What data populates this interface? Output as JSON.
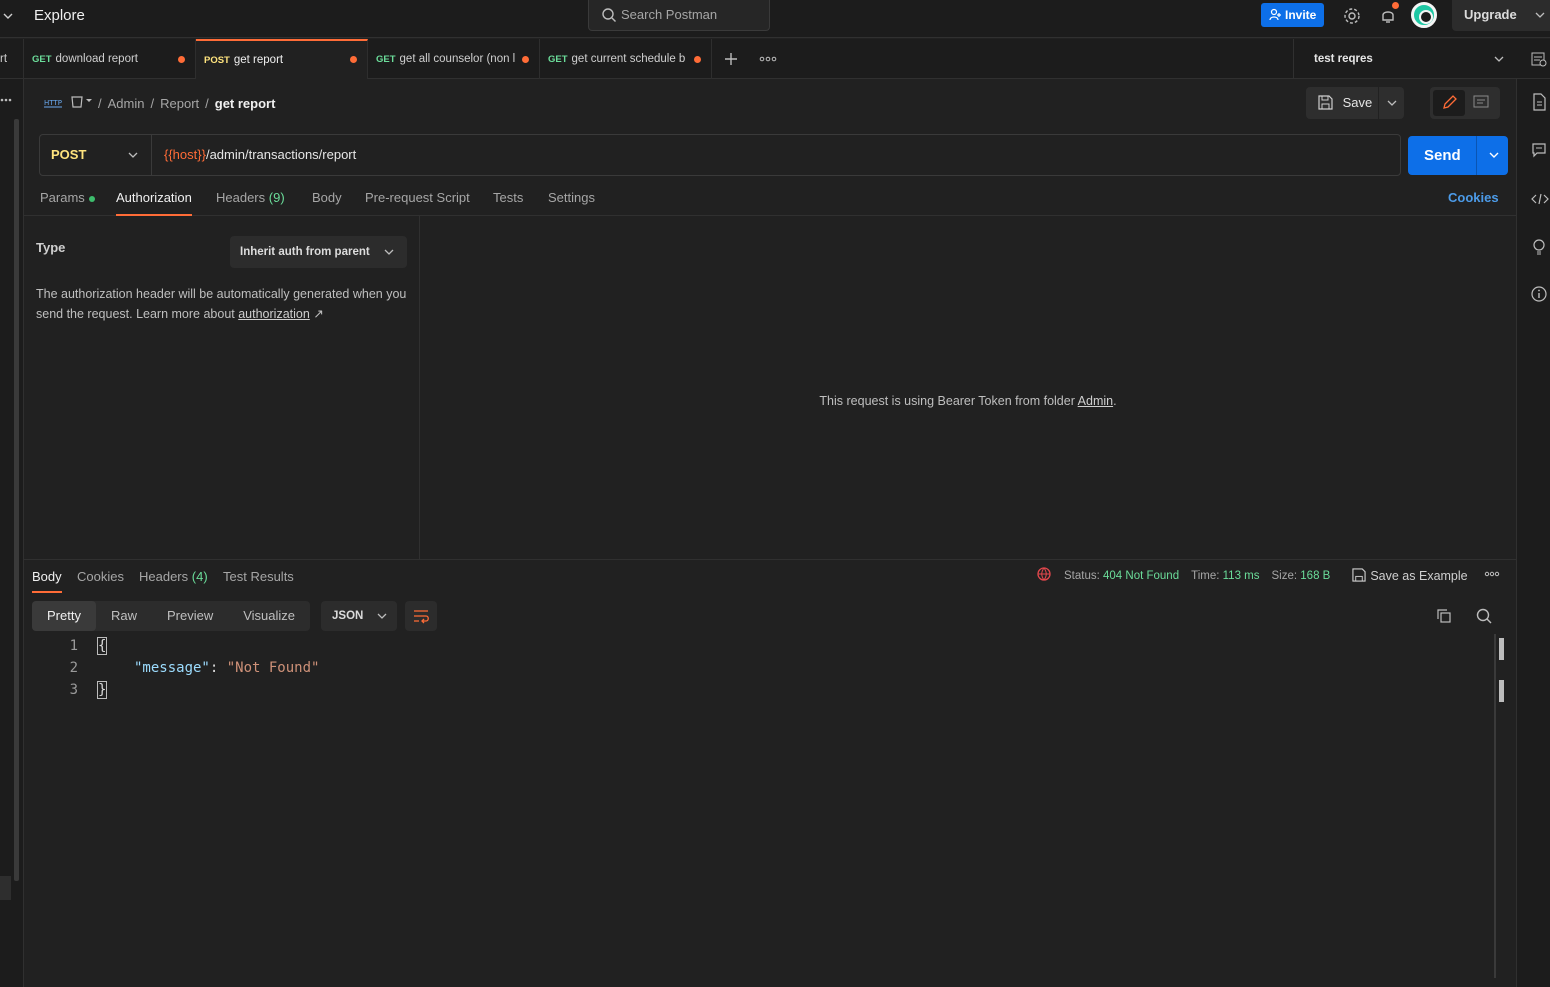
{
  "topbar": {
    "title": "Explore",
    "search_placeholder": "Search Postman",
    "invite_label": "Invite",
    "upgrade_label": "Upgrade"
  },
  "tabs": [
    {
      "prefix": "rt"
    },
    {
      "method": "GET",
      "label": "download report",
      "unsaved": true
    },
    {
      "method": "POST",
      "label": "get report",
      "unsaved": true,
      "active": true
    },
    {
      "method": "GET",
      "label": "get all counselor (non l",
      "unsaved": true
    },
    {
      "method": "GET",
      "label": "get current schedule b",
      "unsaved": true
    }
  ],
  "environment": {
    "name": "test reqres"
  },
  "breadcrumb": {
    "items": [
      "Admin",
      "Report"
    ],
    "current": "get report"
  },
  "save_label": "Save",
  "request": {
    "method": "POST",
    "url_var": "{{host}}",
    "url_path": "/admin/transactions/report",
    "send_label": "Send"
  },
  "request_tabs": {
    "params": "Params",
    "authorization": "Authorization",
    "headers": "Headers",
    "headers_count": "(9)",
    "body": "Body",
    "prerequest": "Pre-request Script",
    "tests": "Tests",
    "settings": "Settings",
    "cookies": "Cookies"
  },
  "auth": {
    "type_label": "Type",
    "type_value": "Inherit auth from parent",
    "desc": "The authorization header will be automatically generated when you send the request. Learn more about ",
    "desc_link": "authorization",
    "desc_arrow": "↗",
    "message_prefix": "This request is using Bearer Token from folder ",
    "message_folder": "Admin",
    "message_suffix": "."
  },
  "response": {
    "tabs": {
      "body": "Body",
      "cookies": "Cookies",
      "headers": "Headers",
      "headers_count": "(4)",
      "tests": "Test Results"
    },
    "status_label": "Status:",
    "status_value": "404 Not Found",
    "time_label": "Time:",
    "time_value": "113 ms",
    "size_label": "Size:",
    "size_value": "168 B",
    "save_example": "Save as Example",
    "views": [
      "Pretty",
      "Raw",
      "Preview",
      "Visualize"
    ],
    "format": "JSON",
    "lines": [
      {
        "n": "1",
        "open": "{"
      },
      {
        "n": "2",
        "key": "\"message\"",
        "colon": ": ",
        "value": "\"Not Found\""
      },
      {
        "n": "3",
        "close": "}"
      }
    ]
  },
  "colors": {
    "accent": "#ff6c37",
    "primary": "#0d6fe8",
    "get": "#6bdd9a",
    "post": "#ffe47e"
  }
}
